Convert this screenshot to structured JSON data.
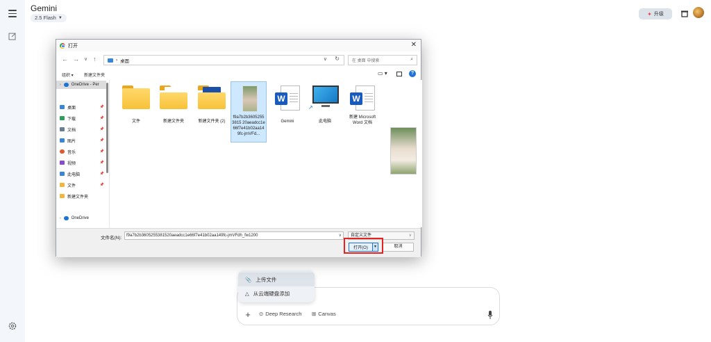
{
  "app": {
    "title": "Gemini",
    "model": "2.5 Flash",
    "upgrade_label": "升级"
  },
  "input": {
    "upload_menu": [
      "上传文件",
      "从云端硬盘添加"
    ],
    "tools": [
      "Deep Research",
      "Canvas"
    ]
  },
  "dialog": {
    "title": "打开",
    "path": "桌面",
    "search_placeholder": "在 桌面 中搜索",
    "toolbar": {
      "organize": "组织 ▾",
      "new_folder": "新建文件夹"
    },
    "sidebar": [
      {
        "label": "OneDrive - Per",
        "color": "#1e73d8"
      },
      {
        "label": "桌面",
        "color": "#3a86d6"
      },
      {
        "label": "下载",
        "color": "#2e9e5b"
      },
      {
        "label": "文档",
        "color": "#6b7d95"
      },
      {
        "label": "图片",
        "color": "#3a86d6"
      },
      {
        "label": "音乐",
        "color": "#e2572f"
      },
      {
        "label": "视频",
        "color": "#8a4ccf"
      },
      {
        "label": "此电脑",
        "color": "#3a86d6"
      },
      {
        "label": "文件",
        "color": "#f2b63c"
      },
      {
        "label": "新建文件夹",
        "color": "#f2b63c"
      },
      {
        "label": "OneDrive",
        "color": "#1e73d8"
      }
    ],
    "files": [
      {
        "name": "文件",
        "kind": "folder"
      },
      {
        "name": "新建文件夹",
        "kind": "folder"
      },
      {
        "name": "新建文件夹 (2)",
        "kind": "folder"
      },
      {
        "name": "f9a7b2b36052553815 20aeadcc1e66f7e41b02aa149fc-jmVFd...",
        "kind": "image"
      },
      {
        "name": "Gemini",
        "kind": "word"
      },
      {
        "name": "此电脑",
        "kind": "computer"
      },
      {
        "name": "新建 Microsoft Word 文档",
        "kind": "word"
      }
    ],
    "filename_label": "文件名(N):",
    "filename_value": "f9a7b2b3605255381520aeadcc1e66f7e41b02aa149fc-jmVFdh_fw1200",
    "filetype": "自定义文件",
    "open_label": "打开(O)",
    "cancel_label": "取消"
  }
}
